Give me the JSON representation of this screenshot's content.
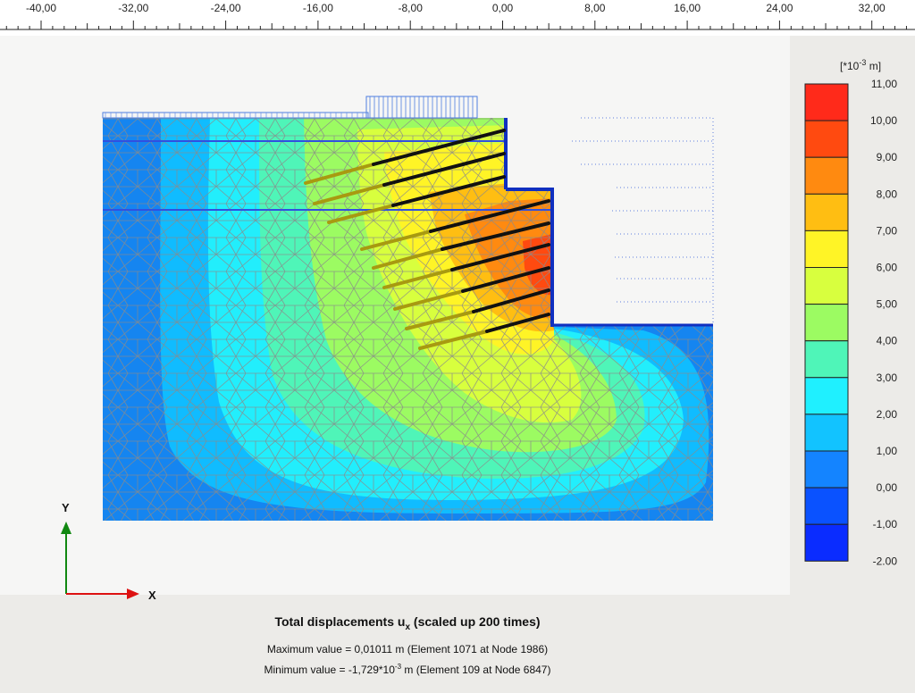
{
  "ruler": {
    "labels": [
      "-40,00",
      "-32,00",
      "-24,00",
      "-16,00",
      "-8,00",
      "0,00",
      "8,00",
      "16,00",
      "24,00",
      "32,00"
    ]
  },
  "legend": {
    "unit_prefix": "[*10",
    "unit_exp": "-3",
    "unit_suffix": " m]",
    "labels": [
      "11,00",
      "10,00",
      "9,00",
      "8,00",
      "7,00",
      "6,00",
      "5,00",
      "4,00",
      "3,00",
      "2,00",
      "1,00",
      "0,00",
      "-1,00",
      "-2.00"
    ],
    "colors": [
      "#ff2a1a",
      "#ff4a10",
      "#ff8a10",
      "#ffbe12",
      "#fff426",
      "#d8ff3e",
      "#9cfb62",
      "#4ff5b8",
      "#1ff0ff",
      "#12c3ff",
      "#1484ff",
      "#0a52ff",
      "#0a2cff"
    ]
  },
  "axes": {
    "x_label": "X",
    "y_label": "Y"
  },
  "caption": {
    "title_main": "Total displacements u",
    "title_sub": "x",
    "title_tail": " (scaled up 200 times)",
    "max_text": "Maximum value = 0,01011 m (Element 1071 at Node 1986)",
    "min_prefix": "Minimum value = -1,729*10",
    "min_exp": "-3",
    "min_suffix": " m (Element 109 at Node 6847)"
  },
  "colors": {
    "field_blue": "#1585f0",
    "field_light_blue": "#10bcff",
    "field_cyan": "#22eefc",
    "field_green": "#7af58a",
    "field_yellow": "#d6f648",
    "field_orange": "#ff9a22",
    "mesh": "#888888",
    "anchor": "#111111",
    "grout": "#a89a10",
    "wall": "#1030c0"
  }
}
